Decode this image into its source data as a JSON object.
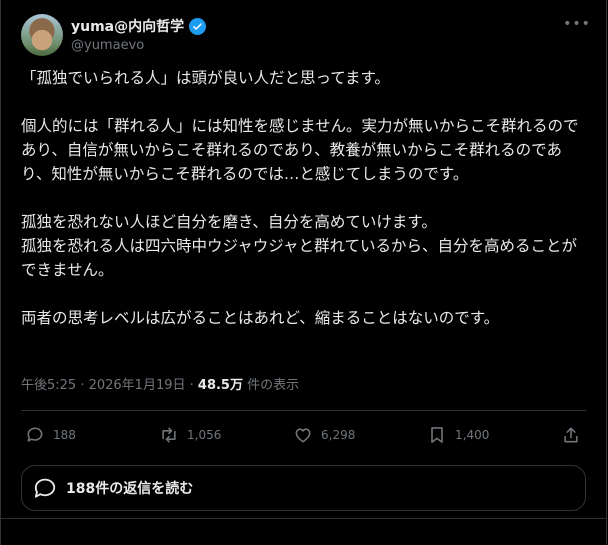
{
  "tweet": {
    "display_name": "yuma@内向哲学",
    "handle": "@yumaevo",
    "text": "「孤独でいられる人」は頭が良い人だと思ってます。\n\n個人的には「群れる人」には知性を感じません。実力が無いからこそ群れるのであり、自信が無いからこそ群れるのであり、教養が無いからこそ群れるのであり、知性が無いからこそ群れるのでは…と感じてしまうのです。\n\n孤独を恐れない人ほど自分を磨き、自分を高めていけます。\n孤独を恐れる人は四六時中ウジャウジャと群れているから、自分を高めることができません。\n\n両者の思考レベルは広がることはあれど、縮まることはないのです。",
    "timestamp": "午後5:25 · 2026年1月19日",
    "separator": " · ",
    "views_count": "48.5万",
    "views_label": "件の表示"
  },
  "actions": {
    "replies": "188",
    "reposts": "1,056",
    "likes": "6,298",
    "bookmarks": "1,400"
  },
  "read_replies": "188件の返信を読む",
  "icons": [
    "verified-badge-icon",
    "more-icon",
    "reply-icon",
    "repost-icon",
    "like-icon",
    "bookmark-icon",
    "share-icon",
    "replies-bubble-icon"
  ],
  "colors": {
    "accent": "#1d9bf0",
    "muted": "#71767b",
    "text": "#e7e9ea",
    "background": "#000000"
  }
}
